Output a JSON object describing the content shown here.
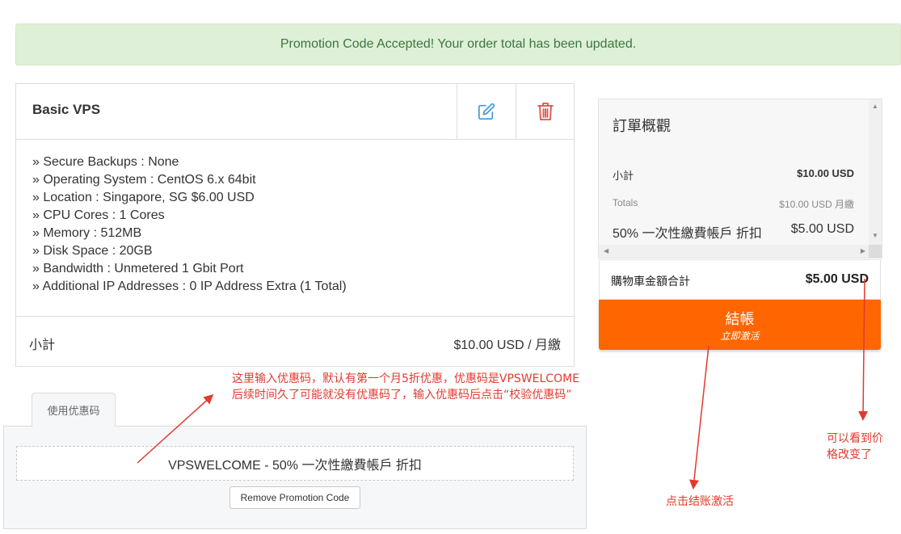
{
  "alert": {
    "message": "Promotion Code Accepted! Your order total has been updated."
  },
  "product": {
    "title": "Basic VPS",
    "details": [
      "» Secure Backups : None",
      "» Operating System : CentOS 6.x 64bit",
      "» Location : Singapore, SG $6.00 USD",
      "» CPU Cores : 1 Cores",
      "» Memory : 512MB",
      "» Disk Space : 20GB",
      "» Bandwidth : Unmetered 1 Gbit Port",
      "» Additional IP Addresses : 0 IP Address Extra (1 Total)"
    ],
    "subtotal_label": "小計",
    "subtotal_value": "$10.00 USD / 月繳",
    "icons": {
      "edit": "edit-icon",
      "delete": "trash-icon"
    },
    "colors": {
      "edit": "#3a9ad9",
      "delete": "#d9534f"
    }
  },
  "promo": {
    "tab_label": "使用优惠码",
    "applied_code": "VPSWELCOME - 50% 一次性繳費帳戶 折扣",
    "remove_label": "Remove Promotion Code"
  },
  "summary": {
    "title": "訂單概觀",
    "subtotal_label": "小計",
    "subtotal_value": "$10.00 USD",
    "totals_label": "Totals",
    "totals_value": "$10.00 USD 月繳",
    "discount_label": "50% 一次性繳費帳戶 折扣",
    "discount_value": "$5.00 USD",
    "total_label": "購物車金額合計",
    "total_value": "$5.00 USD",
    "checkout_label": "結帳",
    "checkout_sublabel": "立即激活",
    "checkout_color": "#ff6600"
  },
  "annotations": {
    "promo_note_line1": "这里输入优惠码，默认有第一个月5折优惠，优惠码是VPSWELCOME",
    "promo_note_line2": "后续时间久了可能就没有优惠码了，输入优惠码后点击“校验优惠码”",
    "checkout_note": "点击结账激活",
    "price_note_line1": "可以看到价",
    "price_note_line2": "格改变了",
    "color": "#e23a2e"
  }
}
